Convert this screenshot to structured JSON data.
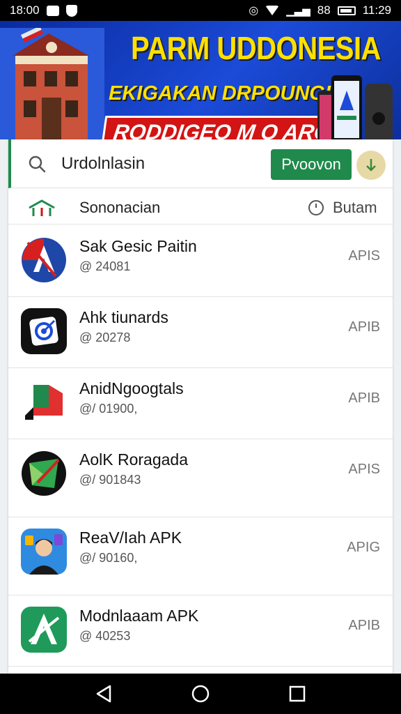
{
  "status_bar": {
    "time_left": "18:00",
    "signal_text": "88",
    "time_right": "11:29"
  },
  "banner": {
    "title": "PARM UDDONESIA",
    "subtitle": "EKIGAKAN DRPOUNGIN",
    "tagline": "RODDIGEO M O ARG!"
  },
  "search": {
    "value": "Urdolnlasin",
    "move_button_label": "Pvoovon"
  },
  "section": {
    "label": "Sononacian",
    "right_label": "Butam"
  },
  "apps": [
    {
      "name": "Sak Gesic Paitin",
      "meta": "@ 24081",
      "type": "APIS",
      "icon": "arrow-a-icon"
    },
    {
      "name": "Ahk tiunards",
      "meta": "@ 20278",
      "type": "APIB",
      "icon": "target-square-icon"
    },
    {
      "name": "AnidNgoogtals",
      "meta": "@/ 01900,",
      "type": "APIB",
      "icon": "red-green-l-icon"
    },
    {
      "name": "AolK Roragada",
      "meta": "@/ 901843",
      "type": "APIS",
      "icon": "green-map-icon"
    },
    {
      "name": "ReaV/Iah APK",
      "meta": "@/ 90160,",
      "type": "APIG",
      "icon": "avatar-icon"
    },
    {
      "name": "Modnlaaam APK",
      "meta": "@ 40253",
      "type": "APIB",
      "icon": "crossed-a-icon"
    }
  ],
  "colors": {
    "accent_green": "#1f8a4c",
    "banner_blue": "#1b4bd8",
    "banner_yellow": "#ffe000",
    "banner_red": "#d21414"
  }
}
